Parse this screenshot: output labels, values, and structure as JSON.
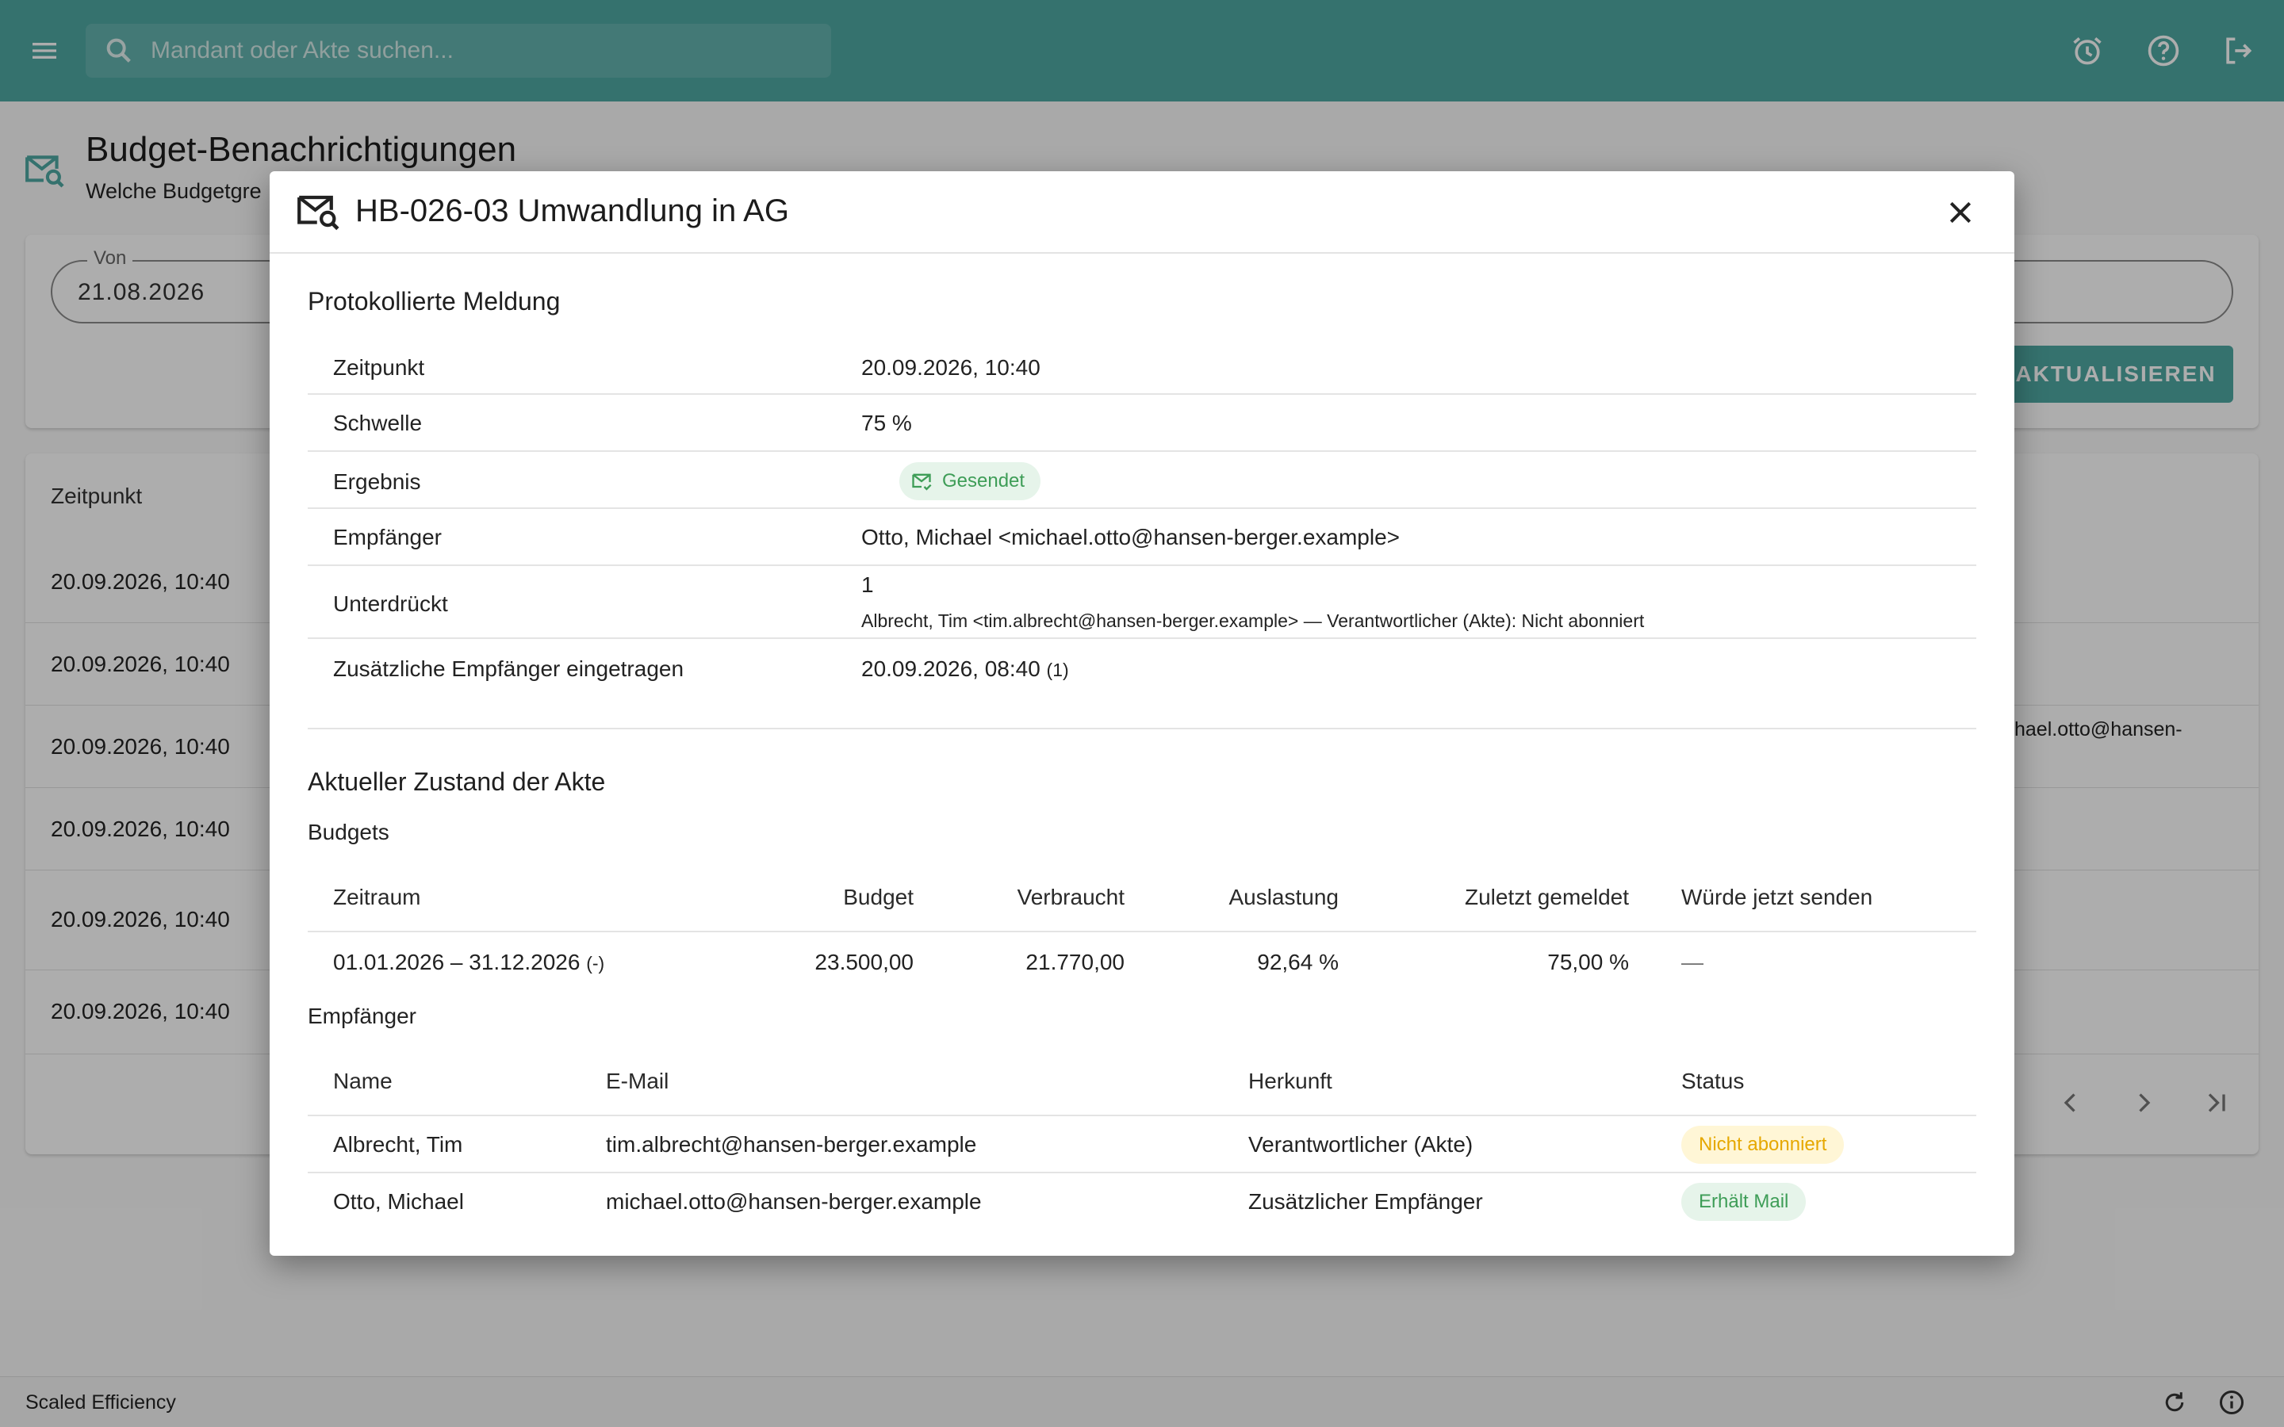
{
  "topbar": {
    "search_placeholder": "Mandant oder Akte suchen...",
    "icons": [
      "menu-icon",
      "search-icon",
      "alarm-icon",
      "help-icon",
      "logout-icon"
    ]
  },
  "page": {
    "title": "Budget-Benachrichtigungen",
    "subtitle": "Welche Budgetgre",
    "filter": {
      "von_label": "Von",
      "von_value": "21.08.2026"
    },
    "refresh_label": "AKTUALISIEREN",
    "table": {
      "col_zeitpunkt": "Zeitpunkt",
      "rows": [
        "20.09.2026, 10:40",
        "20.09.2026, 10:40",
        "20.09.2026, 10:40",
        "20.09.2026, 10:40",
        "20.09.2026, 10:40",
        "20.09.2026, 10:40"
      ],
      "partial_right_text": "hael.otto@hansen-"
    }
  },
  "footer": {
    "text": "Scaled Efficiency"
  },
  "dialog": {
    "title": "HB-026-03 Umwandlung in AG",
    "logged": {
      "section_title": "Protokollierte Meldung",
      "zeitpunkt_label": "Zeitpunkt",
      "zeitpunkt_value": "20.09.2026, 10:40",
      "schwelle_label": "Schwelle",
      "schwelle_value": "75 %",
      "ergebnis_label": "Ergebnis",
      "ergebnis_value": "Gesendet",
      "empfaenger_label": "Empfänger",
      "empfaenger_value": "Otto, Michael <michael.otto@hansen-berger.example>",
      "unterdrueckt_label": "Unterdrückt",
      "unterdrueckt_count": "1",
      "unterdrueckt_detail": "Albrecht, Tim <tim.albrecht@hansen-berger.example> — Verantwortlicher (Akte): Nicht abonniert",
      "zusaetzlich_label": "Zusätzliche Empfänger eingetragen",
      "zusaetzlich_value": "20.09.2026, 08:40",
      "zusaetzlich_count": "(1)"
    },
    "current": {
      "section_title": "Aktueller Zustand der Akte",
      "budgets_title": "Budgets",
      "budgets_headers": {
        "zeitraum": "Zeitraum",
        "budget": "Budget",
        "verbraucht": "Verbraucht",
        "auslastung": "Auslastung",
        "zuletzt": "Zuletzt gemeldet",
        "wuerde": "Würde jetzt senden"
      },
      "budgets_row": {
        "zeitraum": "01.01.2026 – 31.12.2026",
        "zeitraum_note": "(-)",
        "budget": "23.500,00",
        "verbraucht": "21.770,00",
        "auslastung": "92,64 %",
        "zuletzt": "75,00 %",
        "wuerde": "—"
      },
      "recipients_title": "Empfänger",
      "recipients_headers": {
        "name": "Name",
        "email": "E-Mail",
        "herkunft": "Herkunft",
        "status": "Status"
      },
      "recipients": [
        {
          "name": "Albrecht, Tim",
          "email": "tim.albrecht@hansen-berger.example",
          "herkunft": "Verantwortlicher (Akte)",
          "status": "Nicht abonniert"
        },
        {
          "name": "Otto, Michael",
          "email": "michael.otto@hansen-berger.example",
          "herkunft": "Zusätzlicher Empfänger",
          "status": "Erhält Mail"
        }
      ]
    }
  },
  "colors": {
    "accent": "#4ea8a2",
    "success": "#3e9d57",
    "warning": "#e6a800"
  }
}
